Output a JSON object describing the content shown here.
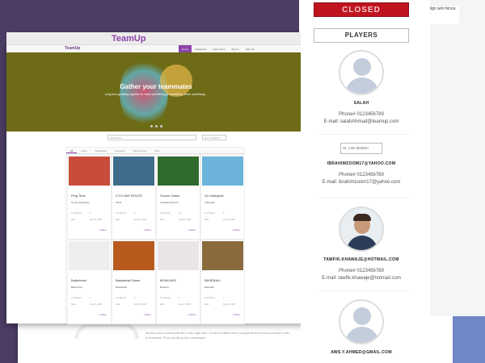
{
  "app": {
    "title": "TeamUp",
    "nav_brand": "TeamUp"
  },
  "nav": {
    "links": [
      "Home",
      "Categories",
      "New Game",
      "Sign In",
      "Sign Up"
    ]
  },
  "hero": {
    "title": "Gather your teammates",
    "subtitle": "Long-form greeting together to: team something go something, share something..."
  },
  "search": {
    "placeholder": "Search for..."
  },
  "filter": {
    "label": "Sort: Newest ▾"
  },
  "tabs": [
    "All",
    "Open",
    "Scheduled",
    "Canceled",
    "Past Games",
    "Mine"
  ],
  "cards": [
    {
      "title": "Ping Time",
      "category": "Tennis (Doubles)",
      "img_color": "#c94b3a",
      "players": "# of Players",
      "players_val": "6",
      "date": "Date",
      "date_val": "Aug 30, 2018",
      "foot": "1 More"
    },
    {
      "title": "CYCLING ROUTE",
      "category": "Other",
      "img_color": "#3f6d8c",
      "players": "# of Players",
      "players_val": "4",
      "date": "Date",
      "date_val": "Aug 24, 2018",
      "foot": "1 More"
    },
    {
      "title": "Soccer Game",
      "category": "Football (Soccer)",
      "img_color": "#2f6b2d",
      "players": "# of Players",
      "players_val": "10",
      "date": "Date",
      "date_val": "Aug 29, 2018",
      "foot": "1 More"
    },
    {
      "title": "Go Volleyball",
      "category": "Volleyball",
      "img_color": "#6bb3d8",
      "players": "# of Players",
      "players_val": "6",
      "date": "Date",
      "date_val": "Aug 22, 2018",
      "foot": "1 More"
    },
    {
      "title": "Badminton",
      "category": "Badminton",
      "img_color": "#eeeeee",
      "players": "# of Players",
      "players_val": "4",
      "date": "Date",
      "date_val": "Aug 24, 2018",
      "foot": "1 More"
    },
    {
      "title": "Basketball Game",
      "category": "Basketball",
      "img_color": "#b85a1e",
      "players": "# of Players",
      "players_val": "8",
      "date": "Date",
      "date_val": "Aug 23, 2018",
      "foot": "1 More"
    },
    {
      "title": "BOWLING!",
      "category": "Bowling",
      "img_color": "#e9e4e8",
      "players": "# of Players",
      "players_val": "4",
      "date": "Date",
      "date_val": "Aug 26, 2018",
      "foot": "1 More"
    },
    {
      "title": "BASEBALL",
      "category": "Baseball",
      "img_color": "#8a6a3d",
      "players": "# of Players",
      "players_val": "9",
      "date": "Date",
      "date_val": "Aug 23, 2018",
      "foot": "1 More"
    }
  ],
  "status": {
    "closed_label": "CLOSED"
  },
  "players_heading": "PLAYERS",
  "players": [
    {
      "name": "SALAH",
      "phone": "Phone# 0123456789",
      "email": "E-mail: salahAhmad@teamup.com",
      "avatar": "default"
    },
    {
      "name": "IBRAHIMZOOM17@YAHOO.COM",
      "phone": "Phone# 0123456789",
      "email": "E-mail: ibrahimzoom17@yahoo.com",
      "avatar": "broken",
      "alt": "Hi, I am Ibrahim"
    },
    {
      "name": "TAWFIK.KHAWAJE@HOTMAIL.COM",
      "phone": "Phone# 0123456789",
      "email": "E-mail: tawfik.khawaje@hotmail.com",
      "avatar": "photo"
    },
    {
      "name": "AWS.Y.AHMED@GMAIL.COM",
      "phone": "",
      "email": "",
      "avatar": "default"
    }
  ],
  "corner_text": "dign wim fenos. ▾",
  "lorem": "Iaculis purus consequat sem cum dign wim. Donec porttitor enim suscipit amet rhoncus posuere odio in tincidunt. Proin iaculis purus consequat."
}
